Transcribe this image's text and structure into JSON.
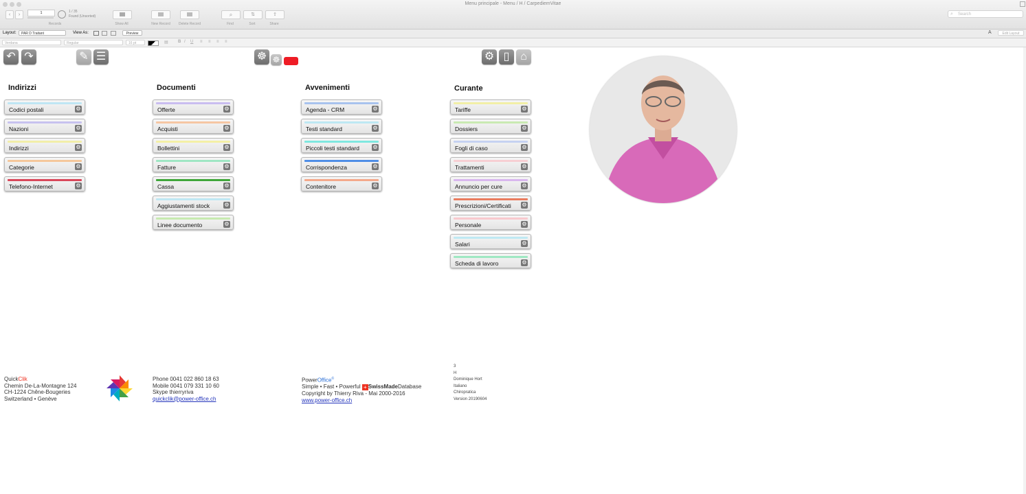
{
  "window": {
    "title": "Menu principale - Menu / H / CarpediemVitae"
  },
  "toolbar": {
    "record_current": "1",
    "record_total": "1 / 35",
    "found_status": "Found (Unsorted)",
    "records_label": "Records",
    "show_all": "Show All",
    "new_record": "New Record",
    "delete_record": "Delete Record",
    "find": "Find",
    "sort": "Sort",
    "share": "Share",
    "search_placeholder": "Search"
  },
  "layoutbar": {
    "layout_label": "Layout:",
    "layout_value": "PAR D Traitant",
    "view_as_label": "View As:",
    "preview": "Preview",
    "edit_layout": "Edit Layout"
  },
  "formatbar": {
    "font": "Verdana",
    "style": "Regular",
    "size": "16 pt"
  },
  "columns": [
    {
      "heading": "Indirizzi",
      "items": [
        {
          "label": "Codici postali",
          "color": "#bfe6f4"
        },
        {
          "label": "Nazioni",
          "color": "#c7c2ef"
        },
        {
          "label": "Indirizzi",
          "color": "#f2eea8"
        },
        {
          "label": "Categorie",
          "color": "#f5c79b"
        },
        {
          "label": "Telefono-Internet",
          "color": "#d9475a"
        }
      ]
    },
    {
      "heading": "Documenti",
      "items": [
        {
          "label": "Offerte",
          "color": "#c9bdf0"
        },
        {
          "label": "Acquisti",
          "color": "#f6c6a3"
        },
        {
          "label": "Bollettini",
          "color": "#f4f0a6"
        },
        {
          "label": "Fatture",
          "color": "#9fe6c4"
        },
        {
          "label": "Cassa",
          "color": "#3fa63a"
        },
        {
          "label": "Aggiustamenti stock",
          "color": "#bfe7f3"
        },
        {
          "label": "Linee documento",
          "color": "#c7eab0"
        }
      ]
    },
    {
      "heading": "Avvenimenti",
      "items": [
        {
          "label": "Agenda - CRM",
          "color": "#a8c3ee"
        },
        {
          "label": "Testi standard",
          "color": "#bde8f3"
        },
        {
          "label": "Piccoli testi standard",
          "color": "#7fe8e0"
        },
        {
          "label": "Corrispondenza",
          "color": "#4f8ee6"
        },
        {
          "label": "Contenitore",
          "color": "#f4a98b"
        }
      ]
    },
    {
      "heading": "Curante",
      "items": [
        {
          "label": "Tariffe",
          "color": "#f2efa6"
        },
        {
          "label": "Dossiers",
          "color": "#c9eab2"
        },
        {
          "label": "Fogli di caso",
          "color": "#c6d2f1"
        },
        {
          "label": "Trattamenti",
          "color": "#f7cfd3"
        },
        {
          "label": "Annuncio per cure",
          "color": "#d9b7ee"
        },
        {
          "label": "Prescrizioni/Certificati",
          "color": "#e97b5e"
        },
        {
          "label": "Personale",
          "color": "#f8c9ce"
        },
        {
          "label": "Salari",
          "color": "#bfe9f3"
        },
        {
          "label": "Scheda di lavoro",
          "color": "#9fe8c2"
        }
      ]
    }
  ],
  "footer": {
    "brand_a": "Quick",
    "brand_b": "Clik",
    "address1": "Chemin De-La-Montagne 124",
    "address2": "CH-1224 Chêne-Bougeries",
    "address3": "Switzerland • Genève",
    "phone": "Phone 0041 022 860 18 63",
    "mobile": "Mobile 0041 079 331 10 60",
    "skype": "Skype thierryriva",
    "email": "quickclik@power-office.ch",
    "po_a": "Power",
    "po_b": "Office",
    "po_reg": "©",
    "tagline_a": "Simple • Fast • Powerful",
    "tagline_b": "SwissMade",
    "tagline_c": "Database",
    "copyright": "Copyright by Thierry Riva - Mai 2000-2016",
    "website": "www.power-office.ch"
  },
  "info": [
    "3",
    "H",
    "Dominique Hort",
    "Italiano",
    "Chiropratica",
    "Version 20190604"
  ]
}
